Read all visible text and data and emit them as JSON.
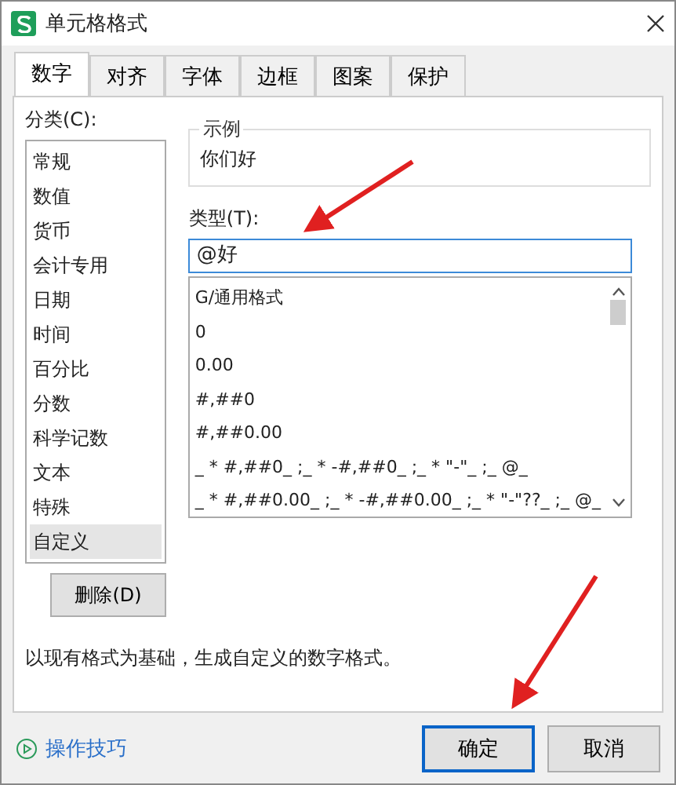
{
  "window": {
    "title": "单元格格式"
  },
  "tabs": [
    {
      "label": "数字",
      "selected": true
    },
    {
      "label": "对齐",
      "selected": false
    },
    {
      "label": "字体",
      "selected": false
    },
    {
      "label": "边框",
      "selected": false
    },
    {
      "label": "图案",
      "selected": false
    },
    {
      "label": "保护",
      "selected": false
    }
  ],
  "category": {
    "label": "分类(C):",
    "items": [
      {
        "label": "常规",
        "selected": false
      },
      {
        "label": "数值",
        "selected": false
      },
      {
        "label": "货币",
        "selected": false
      },
      {
        "label": "会计专用",
        "selected": false
      },
      {
        "label": "日期",
        "selected": false
      },
      {
        "label": "时间",
        "selected": false
      },
      {
        "label": "百分比",
        "selected": false
      },
      {
        "label": "分数",
        "selected": false
      },
      {
        "label": "科学记数",
        "selected": false
      },
      {
        "label": "文本",
        "selected": false
      },
      {
        "label": "特殊",
        "selected": false
      },
      {
        "label": "自定义",
        "selected": true
      }
    ]
  },
  "sample": {
    "label": "示例",
    "value": "你们好"
  },
  "type": {
    "label": "类型(T):",
    "value": "@好",
    "formats": [
      "G/通用格式",
      "0",
      "0.00",
      "#,##0",
      "#,##0.00",
      "_ * #,##0_ ;_ * -#,##0_ ;_ * \"-\"_ ;_ @_",
      "_ * #,##0.00_ ;_ * -#,##0.00_ ;_ * \"-\"??_ ;_ @_"
    ]
  },
  "delete_button": "删除(D)",
  "description": "以现有格式为基础，生成自定义的数字格式。",
  "tips_link": "操作技巧",
  "buttons": [
    {
      "label": "确定",
      "default": true
    },
    {
      "label": "取消",
      "default": false
    }
  ]
}
